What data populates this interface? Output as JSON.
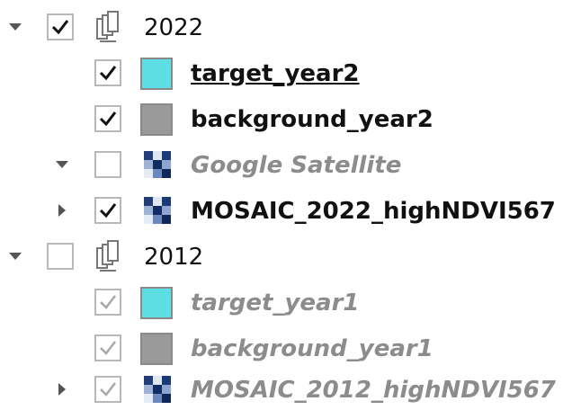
{
  "colors": {
    "target_swatch": "#5ddde4",
    "background_swatch": "#9a9a9a",
    "check_active": "#111111",
    "check_inactive": "#a8a8a8"
  },
  "layers": [
    {
      "label": "2022",
      "kind": "group",
      "expanded": true,
      "checked": true,
      "icon": "layer-group-icon"
    },
    {
      "label": "target_year2",
      "kind": "vector",
      "checked": true,
      "icon": "swatch-cyan"
    },
    {
      "label": "background_year2",
      "kind": "vector",
      "checked": true,
      "icon": "swatch-grey"
    },
    {
      "label": "Google Satellite",
      "kind": "raster",
      "expanded": true,
      "checked": false,
      "icon": "raster-icon"
    },
    {
      "label": "MOSAIC_2022_highNDVI567",
      "kind": "raster",
      "expanded": false,
      "checked": true,
      "icon": "raster-icon"
    },
    {
      "label": "2012",
      "kind": "group",
      "expanded": true,
      "checked": false,
      "icon": "layer-group-icon"
    },
    {
      "label": "target_year1",
      "kind": "vector",
      "checked": true,
      "icon": "swatch-cyan"
    },
    {
      "label": "background_year1",
      "kind": "vector",
      "checked": true,
      "icon": "swatch-grey"
    },
    {
      "label": "MOSAIC_2012_highNDVI567",
      "kind": "raster",
      "expanded": false,
      "checked": true,
      "icon": "raster-icon"
    }
  ]
}
